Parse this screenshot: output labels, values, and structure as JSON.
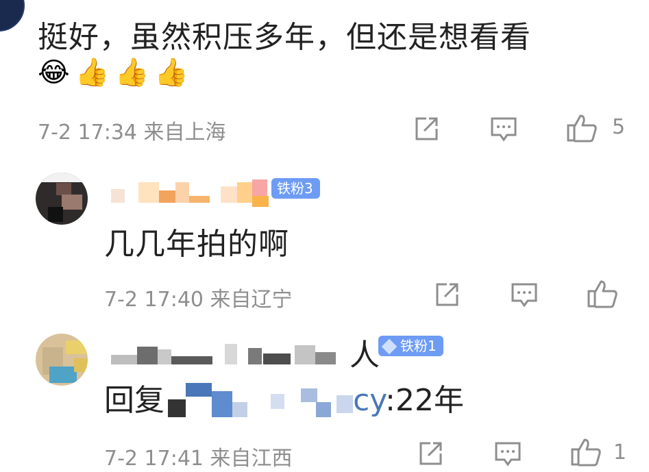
{
  "comments": [
    {
      "text": "挺好，虽然积压多年，但还是想看看",
      "emojis": "😂👍👍👍",
      "meta": "7-2 17:34 来自上海",
      "like_count": "5"
    },
    {
      "badge": "铁粉3",
      "text": "几几年拍的啊",
      "meta": "7-2 17:40 来自辽宁",
      "like_count": ""
    },
    {
      "name_suffix": "人",
      "badge": "铁粉1",
      "reply_prefix": "回复",
      "reply_mention_tail": "cy",
      "reply_text": ":22年",
      "meta": "7-2 17:41 来自江西",
      "like_count": "1"
    }
  ],
  "colors": {
    "text": "#222222",
    "meta": "#8e8e8e",
    "badge": "#6e9cf5",
    "link": "#4a77b7"
  },
  "icons": [
    "share-icon",
    "comment-icon",
    "like-icon",
    "fan-gem-icon"
  ]
}
